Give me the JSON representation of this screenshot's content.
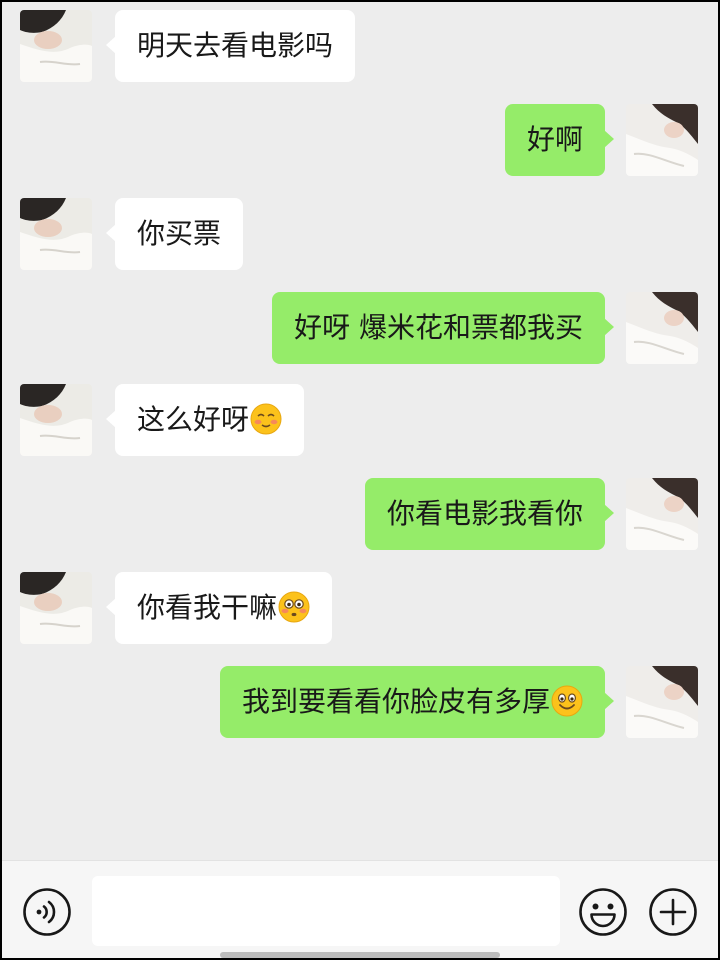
{
  "chat": {
    "messages": [
      {
        "side": "left",
        "text": "明天去看电影吗",
        "emoji": ""
      },
      {
        "side": "right",
        "text": "好啊",
        "emoji": ""
      },
      {
        "side": "left",
        "text": "你买票",
        "emoji": ""
      },
      {
        "side": "right",
        "text": "好呀 爆米花和票都我买",
        "emoji": ""
      },
      {
        "side": "left",
        "text": "这么好呀",
        "emoji": "blush"
      },
      {
        "side": "right",
        "text": "你看电影我看你",
        "emoji": ""
      },
      {
        "side": "left",
        "text": "你看我干嘛",
        "emoji": "flushed"
      },
      {
        "side": "right",
        "text": "我到要看看你脸皮有多厚",
        "emoji": "smile"
      }
    ]
  },
  "input_bar": {
    "text_value": "",
    "icons": [
      "voice-icon",
      "emoji-icon",
      "plus-icon"
    ]
  },
  "colors": {
    "background": "#ededed",
    "sent_bubble": "#95ec69",
    "received_bubble": "#ffffff",
    "text": "#191919"
  }
}
